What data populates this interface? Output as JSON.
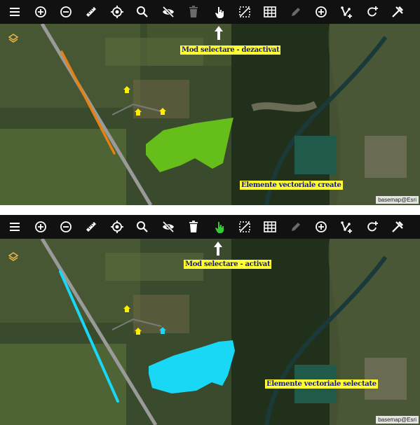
{
  "top": {
    "mode_label": "Mod selectare - dezactivat",
    "elements_label": "Elemente vectoriale create",
    "attribution": "basemap@Esri"
  },
  "bottom": {
    "mode_label": "Mod selectare - activat",
    "elements_label": "Elemente vectoriale selectate",
    "attribution": "basemap@Esri"
  },
  "colors": {
    "toolbar_bg": "#111111",
    "icon": "#ffffff",
    "icon_disabled": "#6a6a6a",
    "select_active": "#33cc33",
    "line_created": "#e8820e",
    "polygon_created": "#6fd219",
    "point_created": "#ffee00",
    "selected": "#19d8f5",
    "label_bg": "#ffff33"
  },
  "toolbar_icons": [
    "menu-icon",
    "zoom-in-icon",
    "zoom-out-icon",
    "ruler-icon",
    "locate-icon",
    "search-icon",
    "visibility-off-icon",
    "delete-icon",
    "select-hand-icon",
    "select-area-icon",
    "table-icon",
    "edit-icon",
    "add-icon",
    "add-vertex-icon",
    "rotate-icon",
    "tools-icon"
  ]
}
